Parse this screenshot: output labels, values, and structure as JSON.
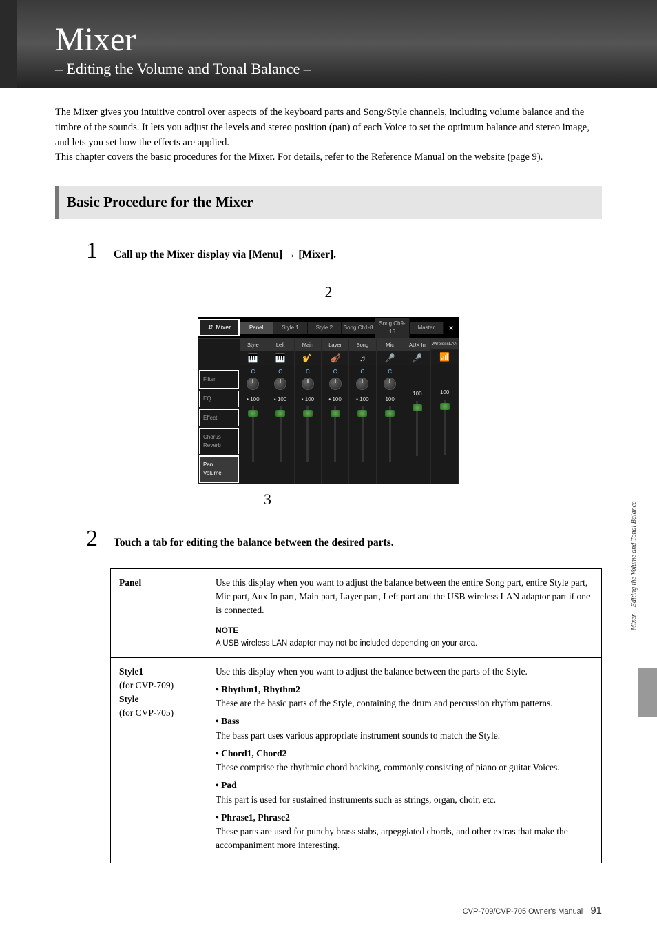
{
  "header": {
    "title": "Mixer",
    "subtitle": "– Editing the Volume and Tonal Balance –"
  },
  "intro": "The Mixer gives you intuitive control over aspects of the keyboard parts and Song/Style channels, including volume balance and the timbre of the sounds. It lets you adjust the levels and stereo position (pan) of each Voice to set the optimum balance and stereo image, and lets you set how the effects are applied.\nThis chapter covers the basic procedures for the Mixer. For details, refer to the Reference Manual on the website (page 9).",
  "section_heading": "Basic Procedure for the Mixer",
  "steps": {
    "1": {
      "num": "1",
      "text": "Call up the Mixer display via [Menu] → [Mixer]."
    },
    "2": {
      "num": "2",
      "text": "Touch a tab for editing the balance between the desired parts."
    }
  },
  "annotation": {
    "top": "2",
    "bottom": "3"
  },
  "mixer_ui": {
    "label": "Mixer",
    "close": "×",
    "tabs": [
      "Panel",
      "Style 1",
      "Style 2",
      "Song Ch1-8",
      "Song Ch9-16",
      "Master"
    ],
    "side_items": [
      "Filter",
      "EQ",
      "Effect",
      "Chorus\nReverb",
      "Pan\nVolume"
    ],
    "channels": [
      {
        "label": "Style",
        "icon": "🎹",
        "pan": "C",
        "vol": "100",
        "dot": true
      },
      {
        "label": "Left",
        "icon": "🎹",
        "pan": "C",
        "vol": "100",
        "dot": true
      },
      {
        "label": "Main",
        "icon": "🎷",
        "pan": "C",
        "vol": "100",
        "dot": true
      },
      {
        "label": "Layer",
        "icon": "🎻",
        "pan": "C",
        "vol": "100",
        "dot": true
      },
      {
        "label": "Song",
        "icon": "♫",
        "pan": "C",
        "vol": "100",
        "dot": true
      },
      {
        "label": "Mic",
        "icon": "🎤",
        "pan": "C",
        "vol": "100",
        "dot": false
      },
      {
        "label": "AUX In",
        "icon": "🎤",
        "pan": "",
        "vol": "100",
        "dot": false
      },
      {
        "label": "WirelessLAN",
        "icon": "📶",
        "pan": "",
        "vol": "100",
        "dot": false
      }
    ]
  },
  "table": {
    "rows": [
      {
        "head": "Panel",
        "desc_main": "Use this display when you want to adjust the balance between the entire Song part, entire Style part, Mic part, Aux In part, Main part, Layer part, Left part and the USB wireless LAN adaptor part if one is connected.",
        "note_label": "NOTE",
        "note_text": "A USB wireless LAN adaptor may not be included depending on your area."
      },
      {
        "head_lines": [
          "Style1",
          "(for CVP-709)",
          "Style",
          "(for CVP-705)"
        ],
        "intro": "Use this display when you want to adjust the balance between the parts of the Style.",
        "bullets": [
          {
            "title": "• Rhythm1, Rhythm2",
            "body": "These are the basic parts of the Style, containing the drum and percussion rhythm patterns."
          },
          {
            "title": "• Bass",
            "body": "The bass part uses various appropriate instrument sounds to match the Style."
          },
          {
            "title": "• Chord1, Chord2",
            "body": "These comprise the rhythmic chord backing, commonly consisting of piano or guitar Voices."
          },
          {
            "title": "• Pad",
            "body": "This part is used for sustained instruments such as strings, organ, choir, etc."
          },
          {
            "title": "• Phrase1, Phrase2",
            "body": "These parts are used for punchy brass stabs, arpeggiated chords, and other extras that make the accompaniment more interesting."
          }
        ]
      }
    ]
  },
  "side_text": "Mixer – Editing the Volume and Tonal Balance –",
  "footer": {
    "doc": "CVP-709/CVP-705 Owner's Manual",
    "page": "91"
  }
}
